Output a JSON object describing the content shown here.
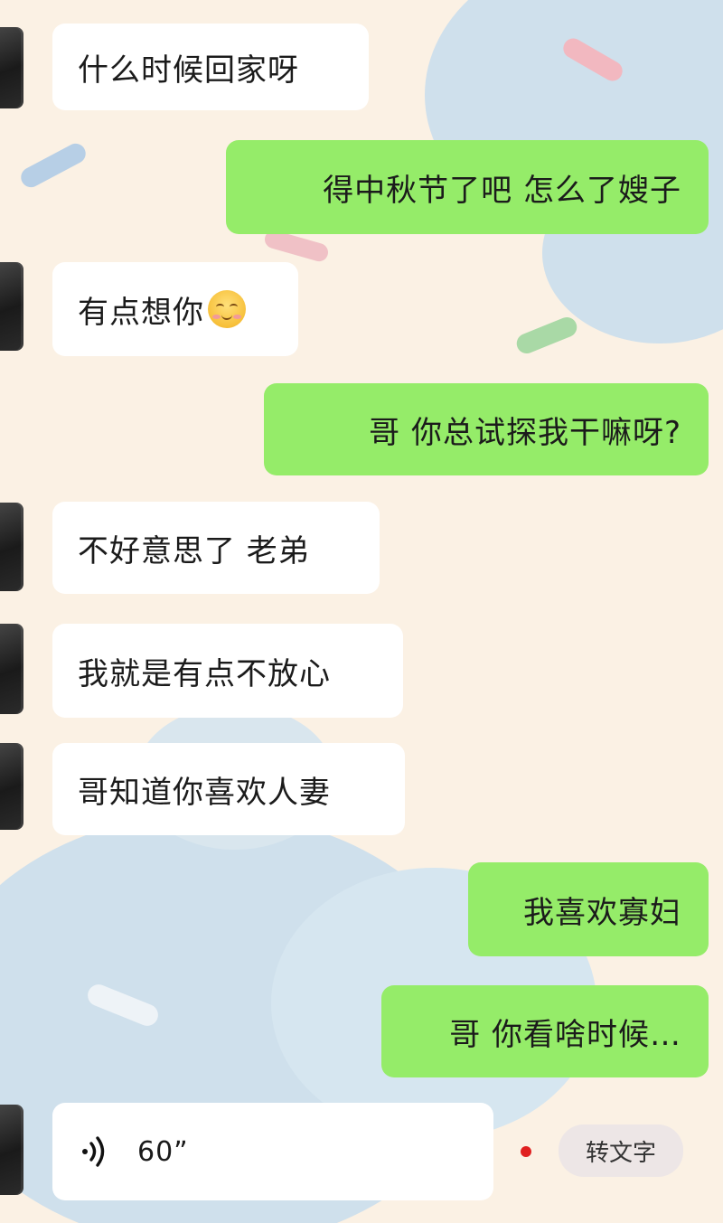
{
  "theme": {
    "outgoing_bubble": "#95ec69",
    "incoming_bubble": "#ffffff",
    "unread_dot": "#e02020"
  },
  "messages": [
    {
      "side": "in",
      "text": "什么时候回家呀"
    },
    {
      "side": "out",
      "text": "得中秋节了吧 怎么了嫂子"
    },
    {
      "side": "in",
      "text": "有点想你",
      "emoji": "blushing-smile-icon"
    },
    {
      "side": "out",
      "text": "哥 你总试探我干嘛呀?"
    },
    {
      "side": "in",
      "text": "不好意思了 老弟"
    },
    {
      "side": "in",
      "text": "我就是有点不放心"
    },
    {
      "side": "in",
      "text": "哥知道你喜欢人妻"
    },
    {
      "side": "out",
      "text": "我喜欢寡妇"
    },
    {
      "side": "out",
      "text": "哥 你看啥时候…"
    }
  ],
  "voice_message": {
    "duration": "60”",
    "icon": "voice-wave-icon",
    "convert_label": "转文字"
  }
}
